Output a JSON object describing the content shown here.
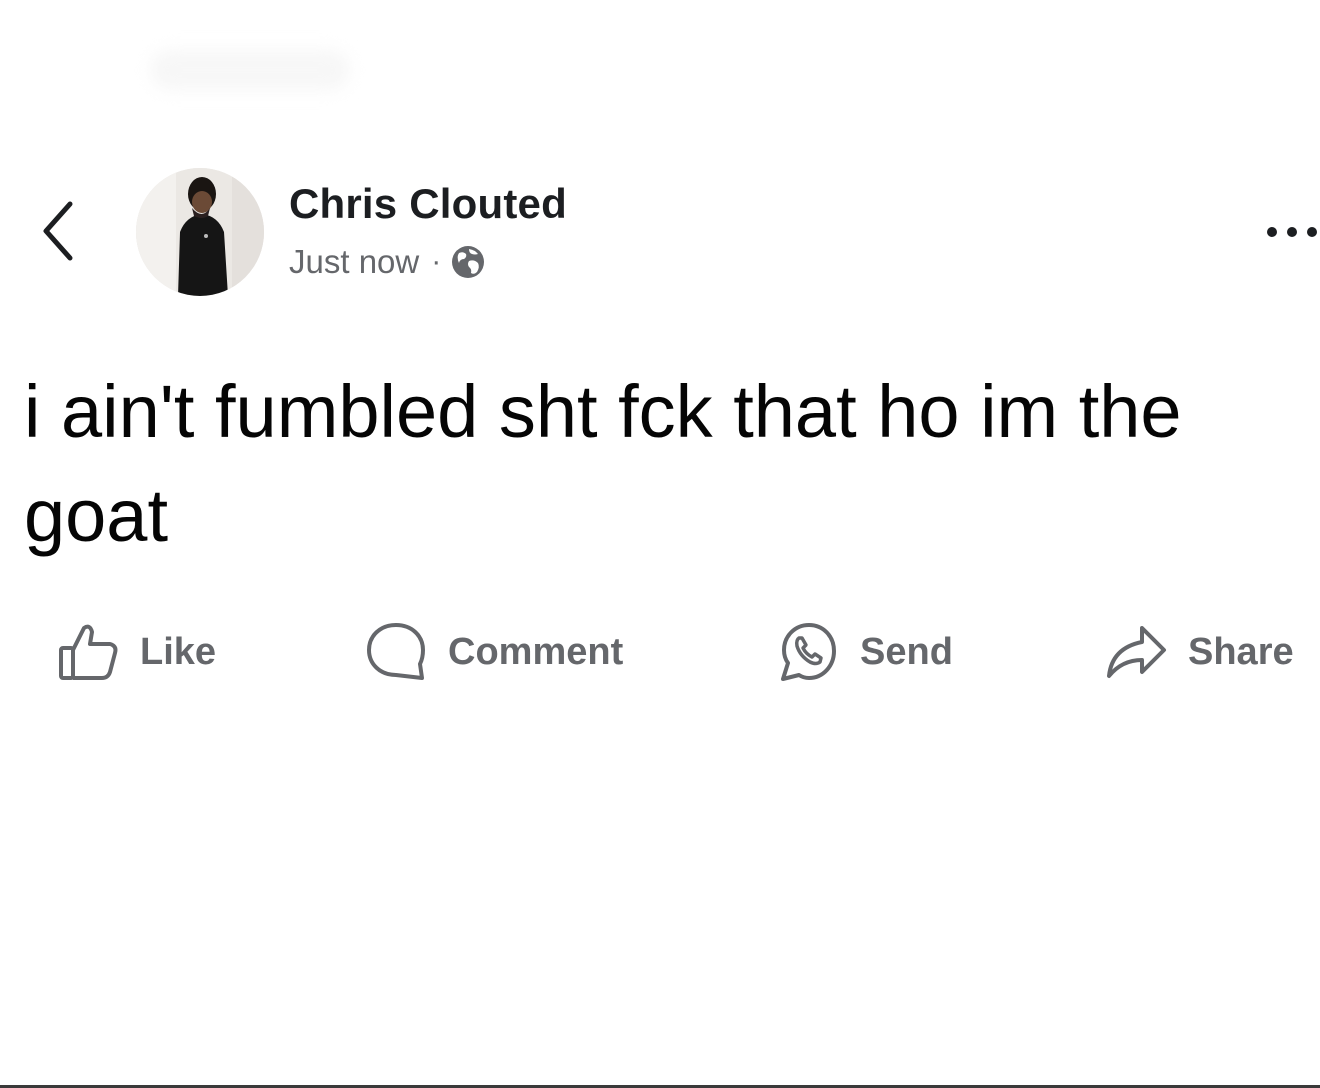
{
  "post": {
    "author_name": "Chris Clouted",
    "timestamp": "Just now",
    "separator": "·",
    "audience_icon": "globe-icon",
    "text": "i ain't fumbled sht fck that ho im the goat"
  },
  "header": {
    "back_icon": "chevron-left-icon",
    "more_icon": "more-horizontal-icon"
  },
  "actions": [
    {
      "label": "Like",
      "icon": "thumbs-up-icon"
    },
    {
      "label": "Comment",
      "icon": "comment-bubble-icon"
    },
    {
      "label": "Send",
      "icon": "whatsapp-icon"
    },
    {
      "label": "Share",
      "icon": "share-arrow-icon"
    }
  ],
  "colors": {
    "text_primary": "#050505",
    "text_secondary": "#65676b",
    "background": "#ffffff"
  }
}
